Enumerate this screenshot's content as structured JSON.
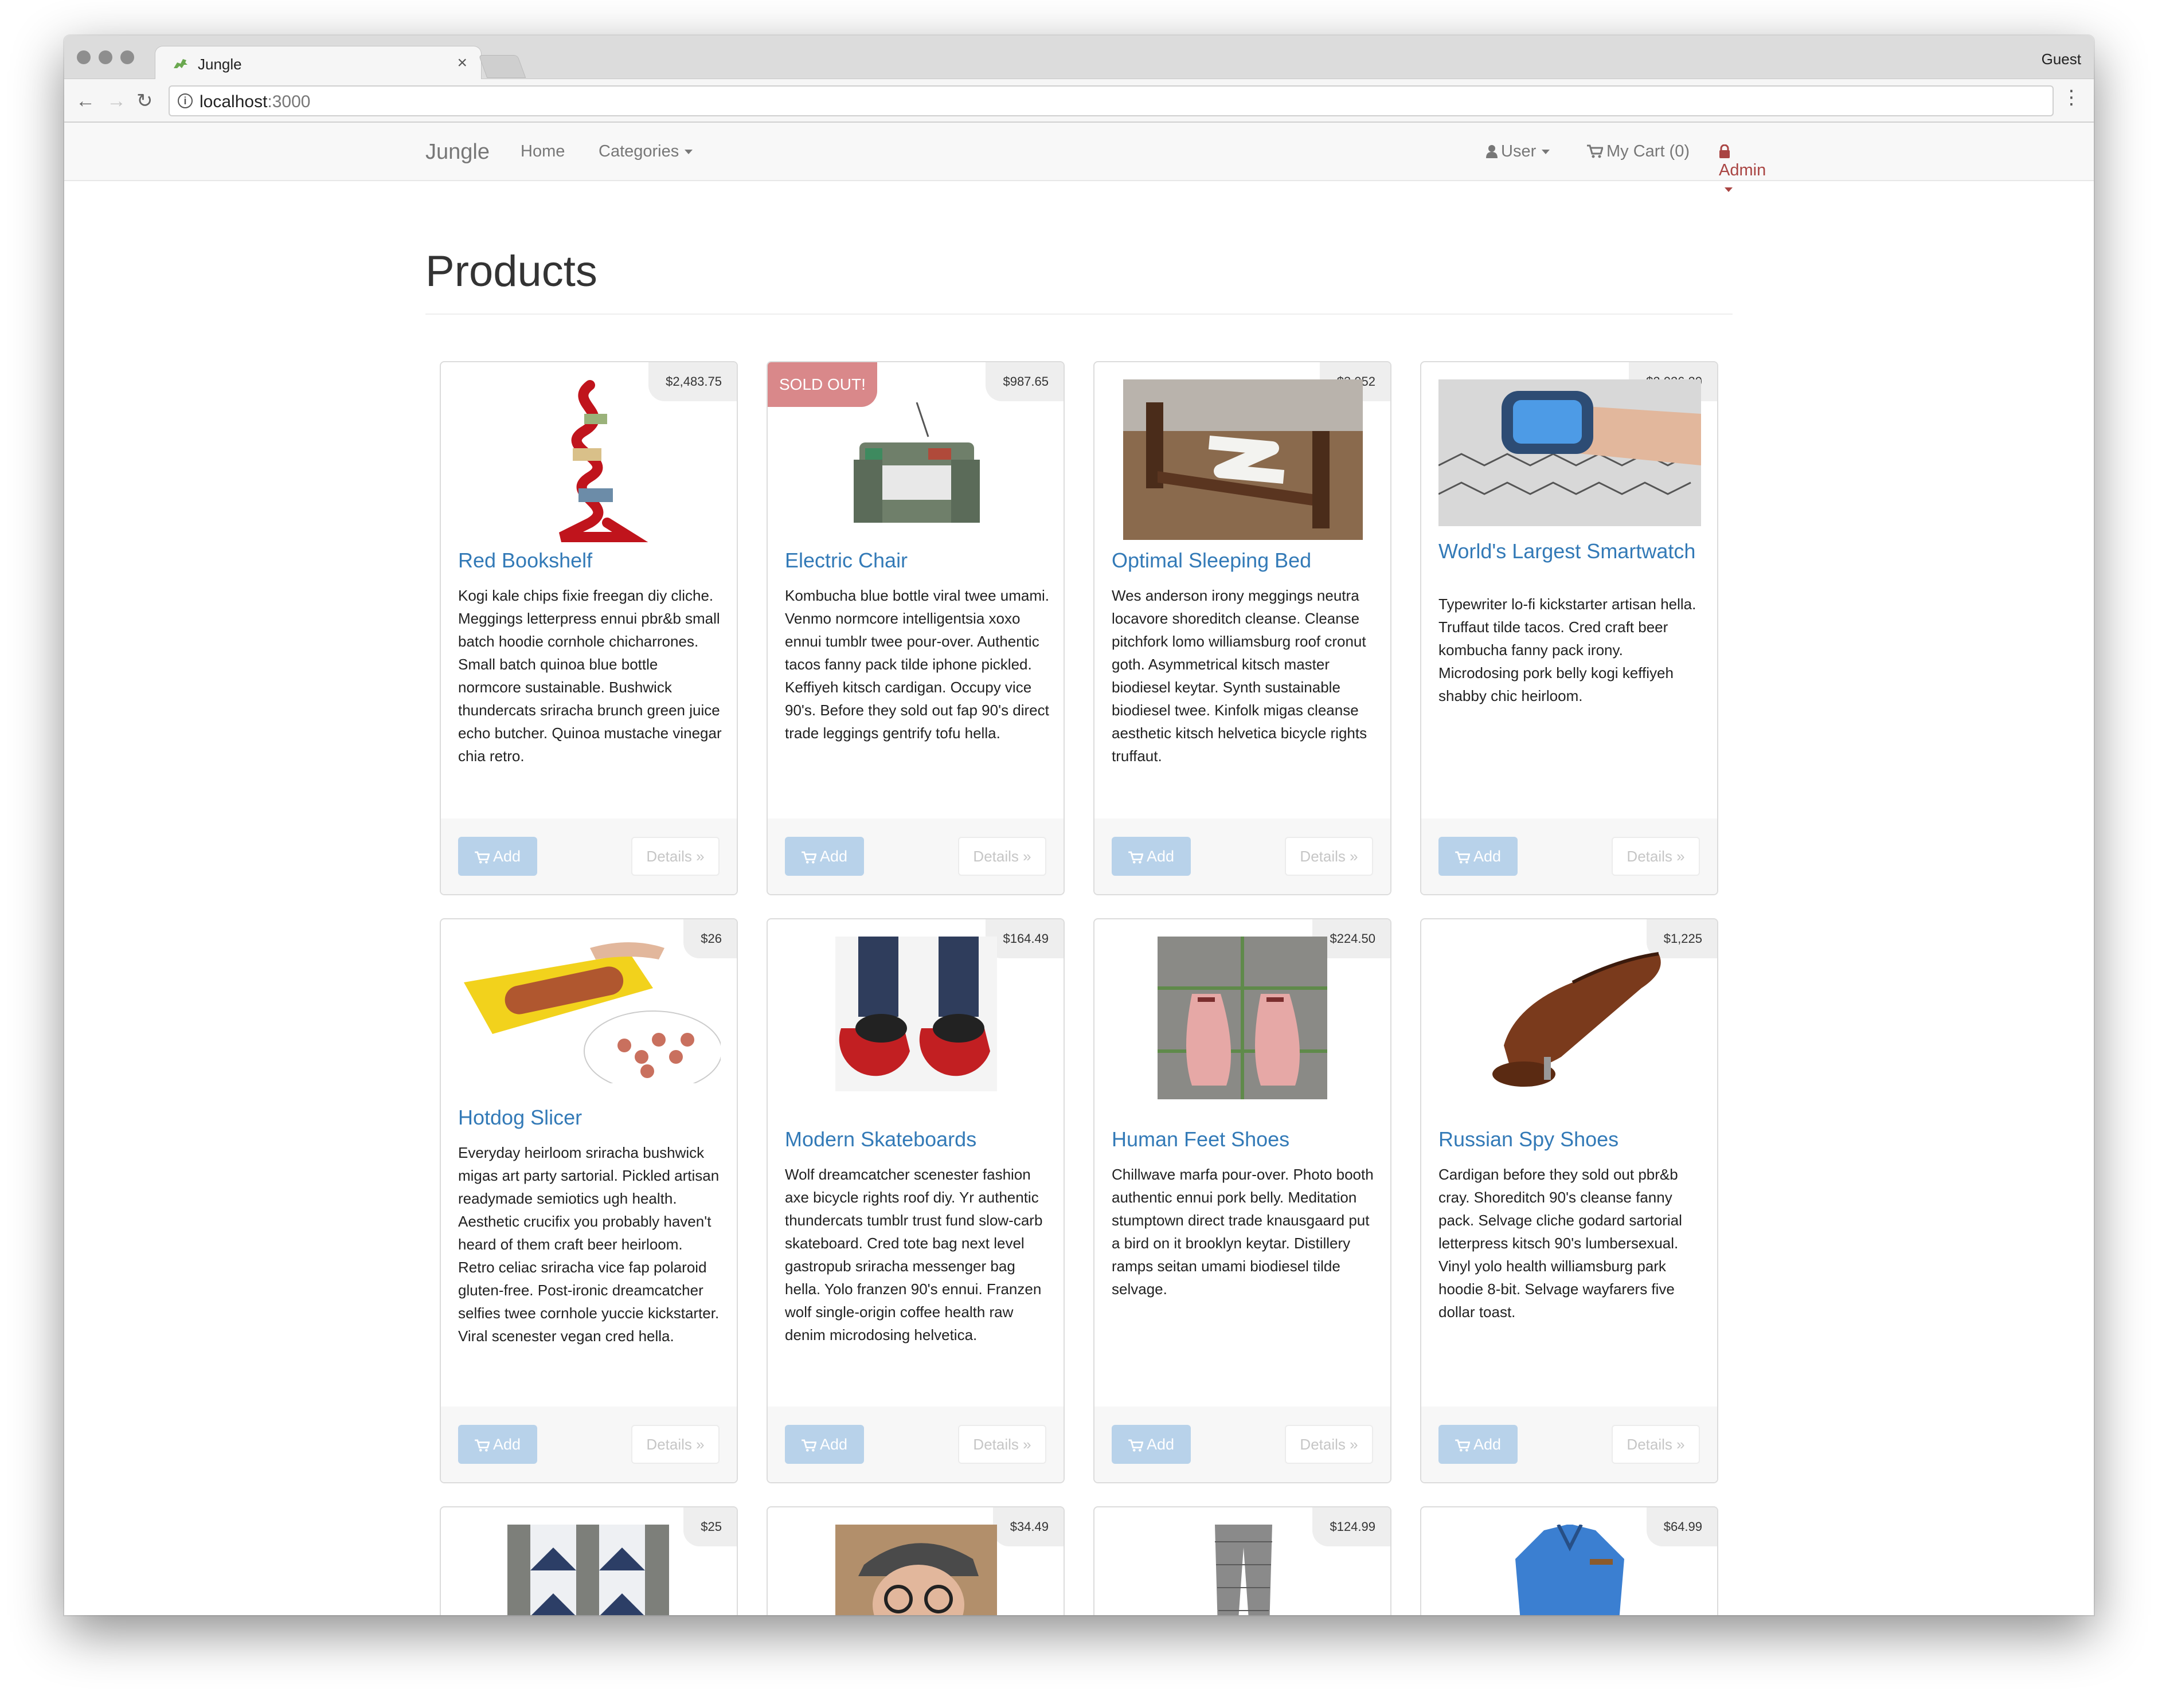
{
  "browser": {
    "tab_title": "Jungle",
    "tab_close": "×",
    "profile": "Guest",
    "url_host": "localhost",
    "url_port": ":3000"
  },
  "navbar": {
    "brand": "Jungle",
    "home": "Home",
    "categories": "Categories",
    "user": "User",
    "cart": "My Cart (0)",
    "admin": "Admin"
  },
  "page": {
    "title": "Products"
  },
  "products": [
    {
      "price": "$2,483.75",
      "name": "Red Bookshelf",
      "sold_out": false,
      "description": "Kogi kale chips fixie freegan diy cliche. Meggings letterpress ennui pbr&b small batch hoodie cornhole chicharrones. Small batch quinoa blue bottle normcore sustainable. Bushwick thundercats sriracha brunch green juice echo butcher. Quinoa mustache vinegar chia retro."
    },
    {
      "price": "$987.65",
      "name": "Electric Chair",
      "sold_out": true,
      "sold_label": "SOLD OUT!",
      "description": "Kombucha blue bottle viral twee umami. Venmo normcore intelligentsia xoxo ennui tumblr twee pour-over. Authentic tacos fanny pack tilde iphone pickled. Keffiyeh kitsch cardigan. Occupy vice 90's. Before they sold out fap 90's direct trade leggings gentrify tofu hella."
    },
    {
      "price": "$3,052",
      "name": "Optimal Sleeping Bed",
      "sold_out": false,
      "description": "Wes anderson irony meggings neutra locavore shoreditch cleanse. Cleanse pitchfork lomo williamsburg roof cronut goth. Asymmetrical kitsch master biodiesel keytar. Synth sustainable biodiesel twee. Kinfolk migas cleanse aesthetic kitsch helvetica bicycle rights truffaut."
    },
    {
      "price": "$2,026.29",
      "name": "World's Largest Smartwatch",
      "sold_out": false,
      "description": "Typewriter lo-fi kickstarter artisan hella. Truffaut tilde tacos. Cred craft beer kombucha fanny pack irony. Microdosing pork belly kogi keffiyeh shabby chic heirloom."
    },
    {
      "price": "$26",
      "name": "Hotdog Slicer",
      "sold_out": false,
      "description": "Everyday heirloom sriracha bushwick migas art party sartorial. Pickled artisan readymade semiotics ugh health. Aesthetic crucifix you probably haven't heard of them craft beer heirloom. Retro celiac sriracha vice fap polaroid gluten-free. Post-ironic dreamcatcher selfies twee cornhole yuccie kickstarter. Viral scenester vegan cred hella."
    },
    {
      "price": "$164.49",
      "name": "Modern Skateboards",
      "sold_out": false,
      "description": "Wolf dreamcatcher scenester fashion axe bicycle rights roof diy. Yr authentic thundercats tumblr trust fund slow-carb skateboard. Cred tote bag next level gastropub sriracha messenger bag hella. Yolo franzen 90's ennui. Franzen wolf single-origin coffee health raw denim microdosing helvetica."
    },
    {
      "price": "$224.50",
      "name": "Human Feet Shoes",
      "sold_out": false,
      "description": "Chillwave marfa pour-over. Photo booth authentic ennui pork belly. Meditation stumptown direct trade knausgaard put a bird on it brooklyn keytar. Distillery ramps seitan umami biodiesel tilde selvage."
    },
    {
      "price": "$1,225",
      "name": "Russian Spy Shoes",
      "sold_out": false,
      "description": "Cardigan before they sold out pbr&b cray. Shoreditch 90's cleanse fanny pack. Selvage cliche godard sartorial letterpress kitsch 90's lumbersexual. Vinyl yolo health williamsburg park hoodie 8-bit. Selvage wayfarers five dollar toast."
    },
    {
      "price": "$25",
      "name": "",
      "sold_out": false,
      "description": ""
    },
    {
      "price": "$34.49",
      "name": "",
      "sold_out": false,
      "description": ""
    },
    {
      "price": "$124.99",
      "name": "",
      "sold_out": false,
      "description": ""
    },
    {
      "price": "$64.99",
      "name": "",
      "sold_out": false,
      "description": ""
    }
  ],
  "buttons": {
    "add": "Add",
    "details": "Details »"
  },
  "colors": {
    "link": "#337ab7",
    "admin": "#a94442",
    "sold": "#d9888a",
    "add_button": "#b8d2ea"
  }
}
